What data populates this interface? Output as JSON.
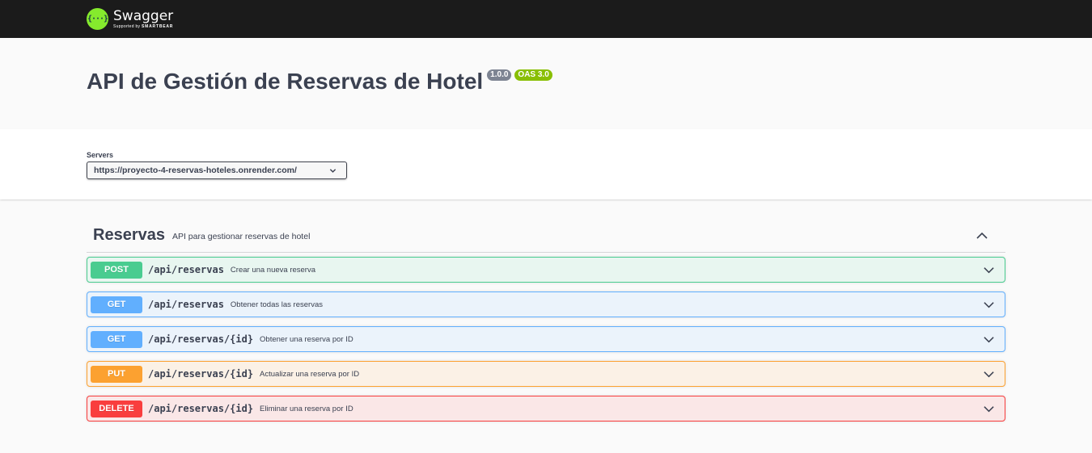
{
  "topbar": {
    "logo_mark": "{···}",
    "logo_name": "Swagger",
    "logo_sub_prefix": "Supported by",
    "logo_sub_brand": "SMARTBEAR",
    "background": "#1b1b1b"
  },
  "info": {
    "title": "API de Gestión de Reservas de Hotel",
    "version_badge": "1.0.0",
    "oas_badge": "OAS 3.0"
  },
  "servers": {
    "label": "Servers",
    "selected": "https://proyecto-4-reservas-hoteles.onrender.com/"
  },
  "tag": {
    "name": "Reservas",
    "description": "API para gestionar reservas de hotel",
    "expanded": true
  },
  "operations": [
    {
      "method": "POST",
      "path": "/api/reservas",
      "summary": "Crear una nueva reserva",
      "color": "#49cc90"
    },
    {
      "method": "GET",
      "path": "/api/reservas",
      "summary": "Obtener todas las reservas",
      "color": "#61affe"
    },
    {
      "method": "GET",
      "path": "/api/reservas/{id}",
      "summary": "Obtener una reserva por ID",
      "color": "#61affe"
    },
    {
      "method": "PUT",
      "path": "/api/reservas/{id}",
      "summary": "Actualizar una reserva por ID",
      "color": "#fca130"
    },
    {
      "method": "DELETE",
      "path": "/api/reservas/{id}",
      "summary": "Eliminar una reserva por ID",
      "color": "#f93e3e"
    }
  ],
  "icons": {
    "logo": "swagger-logo-icon",
    "server_dropdown": "chevron-down-icon",
    "tag_toggle": "chevron-up-icon",
    "operation_expand": "chevron-down-icon"
  }
}
